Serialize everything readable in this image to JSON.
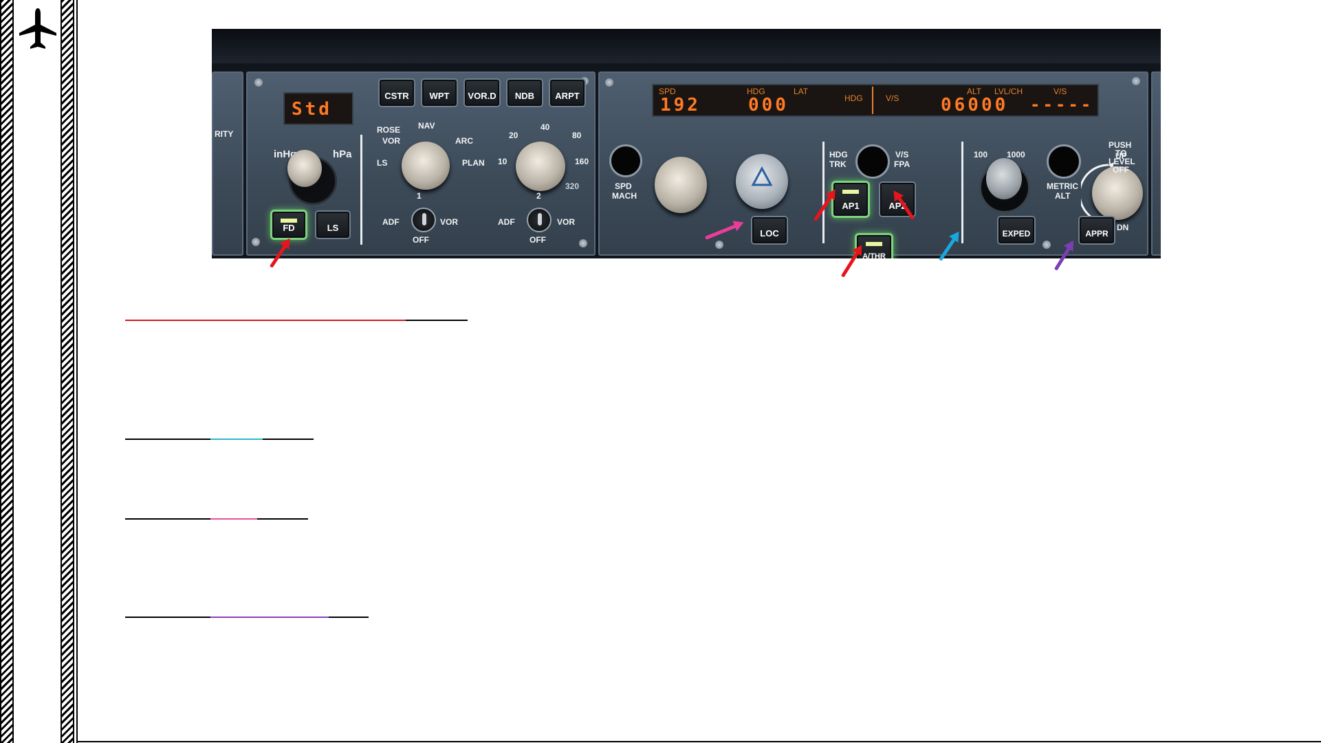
{
  "sidebar": {
    "logo_icon": "airplane-icon"
  },
  "fcu": {
    "efis": {
      "baro_display": "Std",
      "baro_units_left": "inHg",
      "baro_units_right": "hPa",
      "side_label": "RITY",
      "fd_label": "FD",
      "ls_label": "LS",
      "nav_buttons": [
        "CSTR",
        "WPT",
        "VOR.D",
        "NDB",
        "ARPT"
      ],
      "mode_labels": {
        "rose": "ROSE",
        "nav": "NAV",
        "vor": "VOR",
        "arc": "ARC",
        "ls": "LS",
        "plan": "PLAN"
      },
      "range_labels": [
        "20",
        "40",
        "80",
        "10",
        "160",
        "320"
      ],
      "adf1": "ADF",
      "vor1": "VOR",
      "off1": "OFF",
      "num1": "1",
      "adf2": "ADF",
      "vor2": "VOR",
      "off2": "OFF",
      "num2": "2"
    },
    "autopilot": {
      "spd_label": "SPD",
      "spd_value": "192",
      "hdg_label": "HDG",
      "lat_label": "LAT",
      "hdg_value": "000",
      "hdg_label2": "HDG",
      "vs_label": "V/S",
      "alt_label": "ALT",
      "lvlch_label": "LVL/CH",
      "vs_label2": "V/S",
      "alt_value": "06000",
      "vs_value": "-----",
      "spd_mach": "SPD\nMACH",
      "spd_word": "SPD",
      "mach_word": "MACH",
      "hdg_trk_hdg": "HDG",
      "hdg_trk_trk": "TRK",
      "vs_fpa_vs": "V/S",
      "vs_fpa_fpa": "FPA",
      "ap1": "AP1",
      "ap2": "AP2",
      "athr": "A/THR",
      "loc": "LOC",
      "alt_100": "100",
      "alt_1000": "1000",
      "metric": "METRIC",
      "alt_word": "ALT",
      "exped": "EXPED",
      "up": "UP",
      "dn": "DN",
      "push": "PUSH",
      "to": "TO",
      "level": "LEVEL",
      "off": "OFF",
      "appr": "APPR"
    }
  },
  "colors": {
    "arrow_red": "#e8141c",
    "arrow_pink": "#ec3c9a",
    "arrow_cyan": "#1aa7e0",
    "arrow_purple": "#7a3fb2",
    "segment_orange": "#ff7a25"
  },
  "headings": [
    {
      "name": "heading-red",
      "accent": "#d8151d"
    },
    {
      "name": "heading-cyan",
      "accent": "#2fb7c8"
    },
    {
      "name": "heading-pink",
      "accent": "#e84f9a"
    },
    {
      "name": "heading-purple",
      "accent": "#8a3fc0"
    }
  ]
}
